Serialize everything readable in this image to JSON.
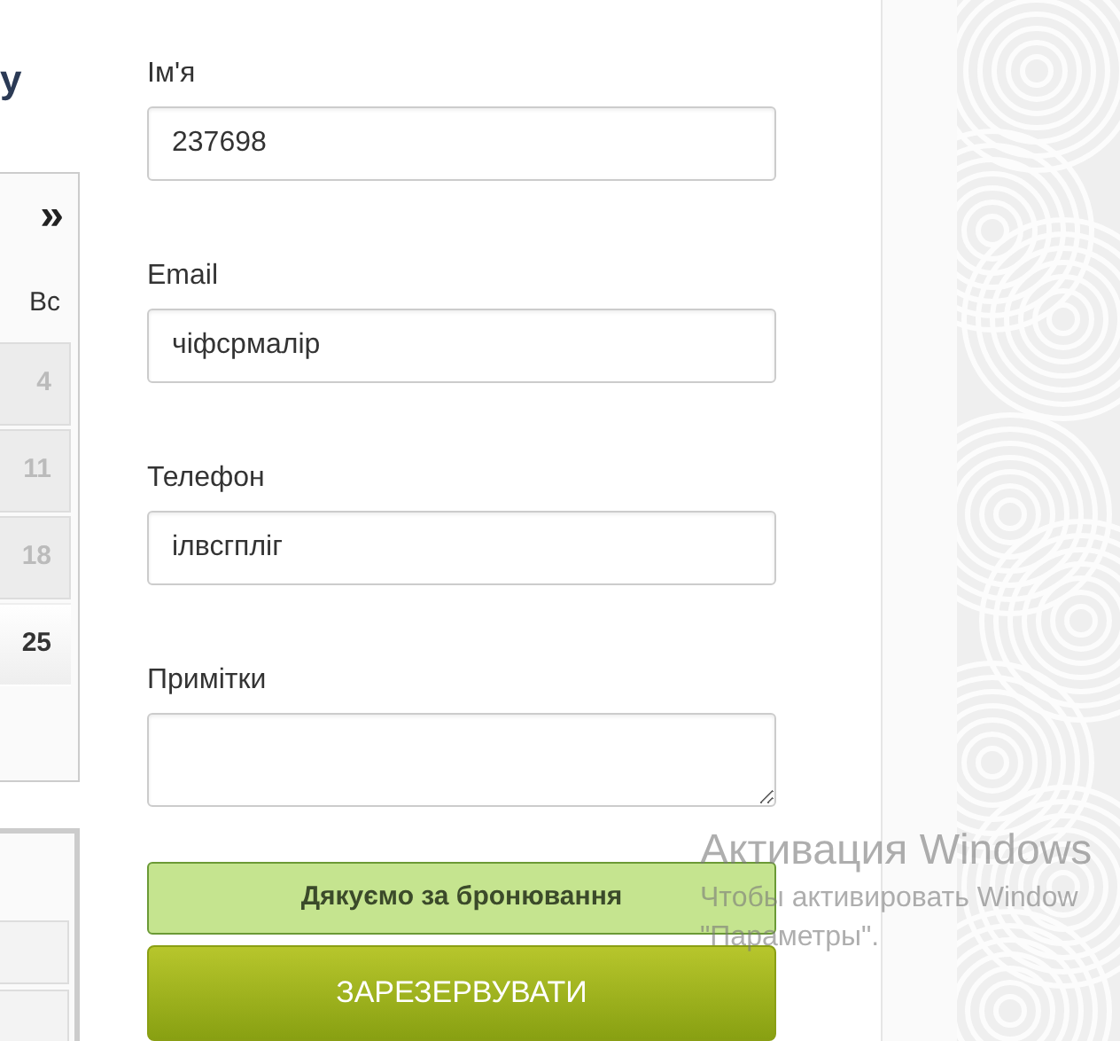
{
  "heading_fragment": "у",
  "calendar": {
    "next": "»",
    "weekday": "Вс",
    "days": [
      {
        "label": "4",
        "disabled": true
      },
      {
        "label": "11",
        "disabled": true
      },
      {
        "label": "18",
        "disabled": true
      },
      {
        "label": "25",
        "disabled": false
      }
    ]
  },
  "form": {
    "fields": [
      {
        "label": "Ім'я",
        "value": "237698",
        "kind": "input"
      },
      {
        "label": "Email",
        "value": "чіфсрмалір",
        "kind": "input"
      },
      {
        "label": "Телефон",
        "value": "ілвсгпліг",
        "kind": "input"
      },
      {
        "label": "Примітки",
        "kind": "textarea"
      }
    ],
    "message": "Дякуємо за бронювання",
    "submit": "ЗАРЕЗЕРВУВАТИ"
  },
  "os_notice": {
    "title": "Активация Windows",
    "lines": [
      "Чтобы активировать Window",
      "\"Параметры\"."
    ]
  }
}
